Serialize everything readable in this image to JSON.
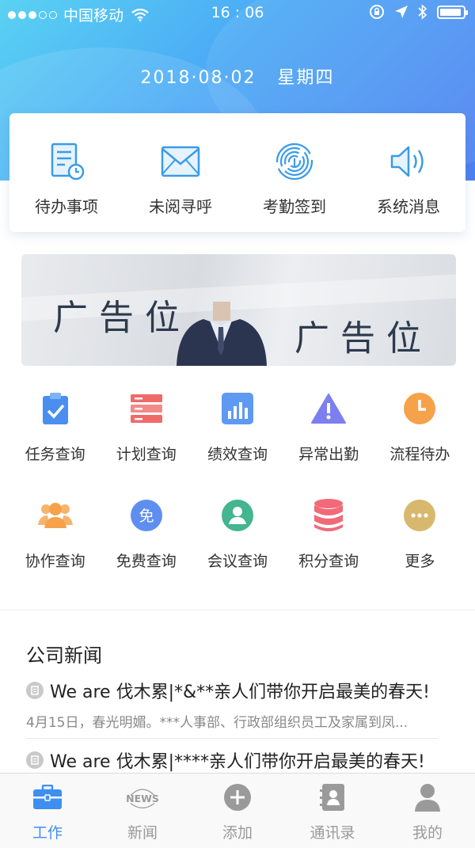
{
  "status_bar": {
    "carrier": "中国移动",
    "time": "16 : 06"
  },
  "header": {
    "date": "2018·08·02",
    "weekday": "星期四"
  },
  "quick_actions": [
    {
      "label": "待办事项",
      "icon": "todo-document-icon"
    },
    {
      "label": "未阅寻呼",
      "icon": "envelope-icon"
    },
    {
      "label": "考勤签到",
      "icon": "fingerprint-icon"
    },
    {
      "label": "系统消息",
      "icon": "speaker-icon"
    }
  ],
  "banner": {
    "left_text": "广告位",
    "right_text": "广告位"
  },
  "grid": [
    {
      "label": "任务查询",
      "icon": "clipboard-check-icon",
      "color": "#4a8ff0"
    },
    {
      "label": "计划查询",
      "icon": "list-icon",
      "color": "#f06a6a"
    },
    {
      "label": "绩效查询",
      "icon": "bar-chart-icon",
      "color": "#5f9af2"
    },
    {
      "label": "异常出勤",
      "icon": "warning-icon",
      "color": "#7b7ff0"
    },
    {
      "label": "流程待办",
      "icon": "clock-icon",
      "color": "#f5a24a"
    },
    {
      "label": "协作查询",
      "icon": "group-icon",
      "color": "#f5a24a"
    },
    {
      "label": "免费查询",
      "icon": "free-badge-icon",
      "color": "#5e8ff0"
    },
    {
      "label": "会议查询",
      "icon": "person-icon",
      "color": "#43b58f"
    },
    {
      "label": "积分查询",
      "icon": "database-icon",
      "color": "#f06a78"
    },
    {
      "label": "更多",
      "icon": "more-icon",
      "color": "#d7b86d"
    }
  ],
  "news": {
    "title": "公司新闻",
    "items": [
      {
        "headline": "We are 伐木累|*&**亲人们带你开启最美的春天!",
        "summary": "4月15日，春光明媚。***人事部、行政部组织员工及家属到凤..."
      },
      {
        "headline": "We are 伐木累|****亲人们带你开启最美的春天!",
        "summary": ""
      }
    ]
  },
  "tabbar": {
    "tabs": [
      {
        "label": "工作",
        "icon": "briefcase-icon",
        "active": true
      },
      {
        "label": "新闻",
        "icon": "news-icon",
        "active": false
      },
      {
        "label": "添加",
        "icon": "add-icon",
        "active": false
      },
      {
        "label": "通讯录",
        "icon": "contacts-icon",
        "active": false
      },
      {
        "label": "我的",
        "icon": "user-icon",
        "active": false
      }
    ],
    "news_icon_text": "NEWS"
  },
  "colors": {
    "accent": "#3e8ff0",
    "header_start": "#5ad2f3",
    "header_end": "#4f7ff0"
  }
}
